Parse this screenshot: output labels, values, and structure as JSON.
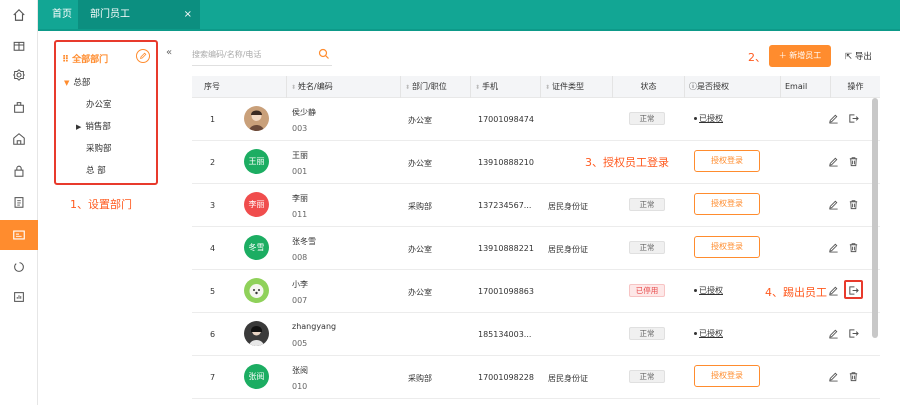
{
  "tabs": {
    "home": "首页",
    "active": "部门员工",
    "close": "×"
  },
  "dept": {
    "header": "全部部门",
    "root": "总部",
    "children": [
      "办公室",
      "销售部",
      "采购部",
      "总 部"
    ],
    "annotation": "1、设置部门"
  },
  "search": {
    "placeholder": "搜索编码/名称/电话"
  },
  "toolbar": {
    "annotation_add": "2、",
    "add_label": "＋ 新增员工",
    "export_label": "导出"
  },
  "table": {
    "headers": [
      "序号",
      "姓名/编码",
      "部门/职位",
      "手机",
      "证件类型",
      "状态",
      "是否授权",
      "Email",
      "操作"
    ],
    "rows": [
      {
        "no": "1",
        "name": "侯少静",
        "code": "003",
        "avatar_text": "",
        "dept": "办公室",
        "phone": "17001098474",
        "id_type": "",
        "status": "正常",
        "auth": "已授权"
      },
      {
        "no": "2",
        "name": "王丽",
        "code": "001",
        "avatar_text": "王丽",
        "dept": "办公室",
        "phone": "13910888210",
        "id_type": "",
        "status": "",
        "auth_btn": "授权登录"
      },
      {
        "no": "3",
        "name": "李丽",
        "code": "011",
        "avatar_text": "李丽",
        "dept": "采购部",
        "phone": "137234567...",
        "id_type": "居民身份证",
        "status": "正常",
        "auth_btn": "授权登录"
      },
      {
        "no": "4",
        "name": "张冬雪",
        "code": "008",
        "avatar_text": "冬雪",
        "dept": "办公室",
        "phone": "13910888221",
        "id_type": "居民身份证",
        "status": "正常",
        "auth_btn": "授权登录"
      },
      {
        "no": "5",
        "name": "小李",
        "code": "007",
        "avatar_text": "",
        "dept": "办公室",
        "phone": "17001098863",
        "id_type": "",
        "status": "已停用",
        "auth": "已授权"
      },
      {
        "no": "6",
        "name": "zhangyang",
        "code": "005",
        "avatar_text": "",
        "dept": "",
        "phone": "185134003...",
        "id_type": "",
        "status": "正常",
        "auth": "已授权"
      },
      {
        "no": "7",
        "name": "张阅",
        "code": "010",
        "avatar_text": "张阅",
        "dept": "采购部",
        "phone": "17001098228",
        "id_type": "居民身份证",
        "status": "正常",
        "auth_btn": "授权登录"
      }
    ]
  },
  "annotations": {
    "auth": "3、授权员工登录",
    "kick": "4、踢出员工"
  },
  "colors": {
    "primary": "#12a694",
    "accent": "#ff8c2e",
    "highlight": "#e83a2c"
  }
}
